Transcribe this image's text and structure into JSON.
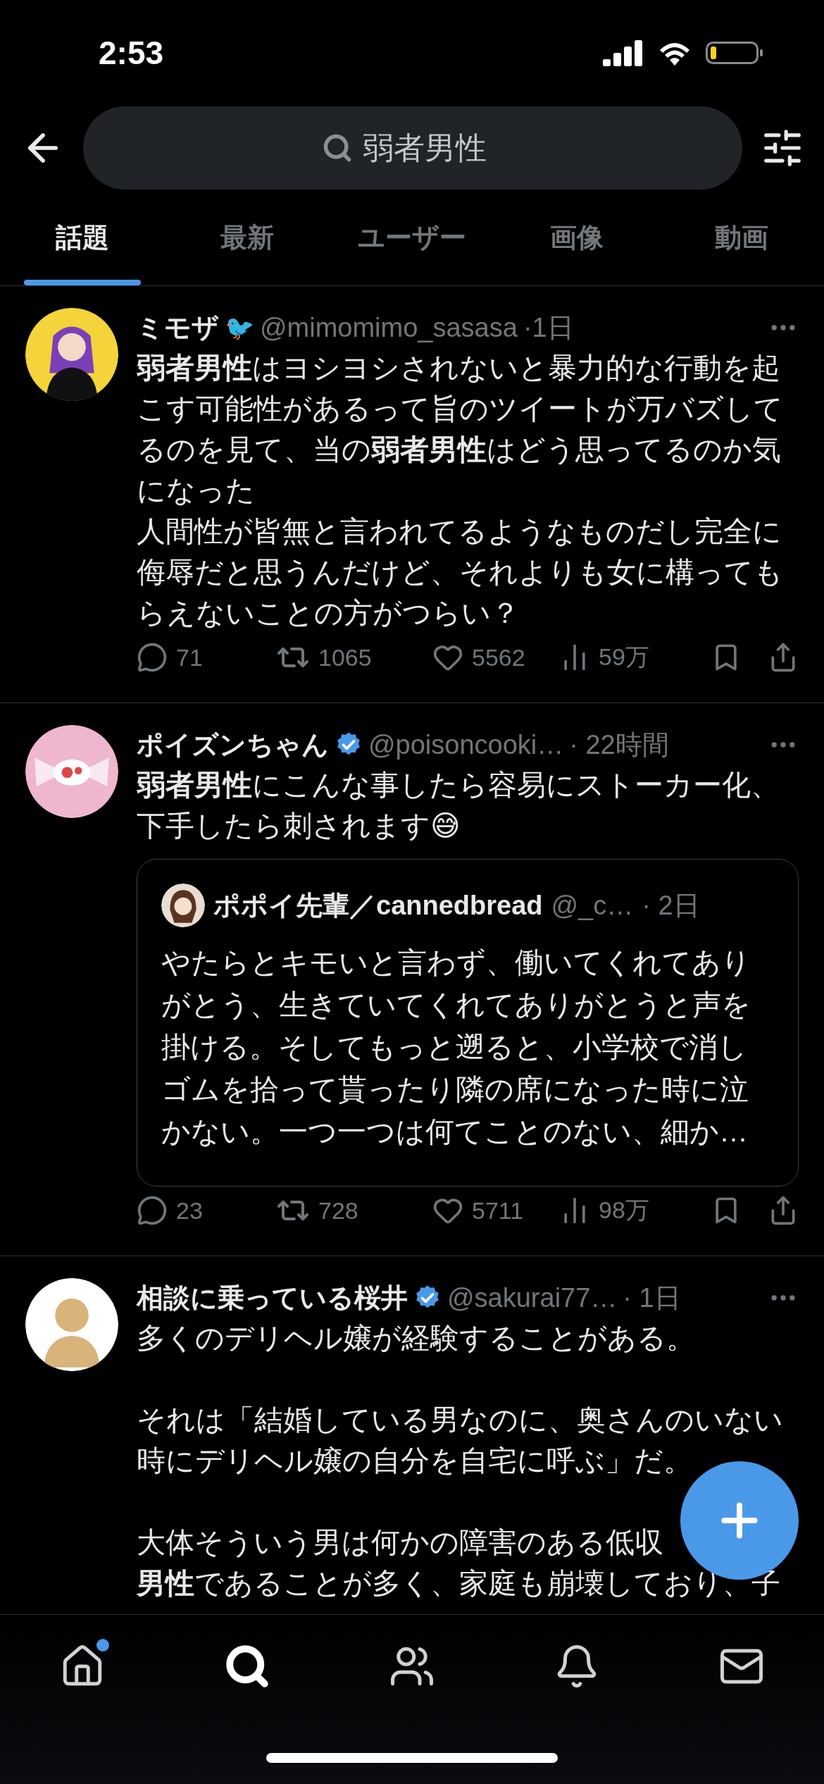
{
  "status_bar": {
    "time": "2:53"
  },
  "search": {
    "value": "弱者男性"
  },
  "tabs": [
    {
      "label": "話題",
      "selected": true
    },
    {
      "label": "最新",
      "selected": false
    },
    {
      "label": "ユーザー",
      "selected": false
    },
    {
      "label": "画像",
      "selected": false
    },
    {
      "label": "動画",
      "selected": false
    }
  ],
  "tweets": [
    {
      "name": "ミモザ",
      "name_emoji": "🐦",
      "verified": false,
      "handle": "@mimomimo_sasasa",
      "time": "·1日",
      "paragraphs": [
        [
          "**弱者男性**はヨシヨシされないと暴力的な行動を起こす可能性があるって旨のツイートが万バズしてるのを見て、当の**弱者男性**はどう思ってるのか気になった",
          "人間性が皆無と言われてるようなものだし完全に侮辱だと思うんだけど、それよりも女に構ってもらえないことの方がつらい？"
        ]
      ],
      "stats": {
        "replies": "71",
        "reposts": "1065",
        "likes": "5562",
        "views": "59万"
      }
    },
    {
      "name": "ポイズンちゃん",
      "verified": true,
      "handle": "@poisoncooki…",
      "time": "· 22時間",
      "paragraphs": [
        [
          "**弱者男性**にこんな事したら容易にストーカー化、下手したら刺されます😅"
        ]
      ],
      "quote": {
        "name": "ポポイ先輩／cannedbread",
        "handle": "@_c…",
        "time": "· 2日",
        "body": "やたらとキモいと言わず、働いてくれてありがとう、生きていてくれてありがとうと声を掛ける。そしてもっと遡ると、小学校で消しゴムを拾って貰ったり隣の席になった時に泣かない。一つ一つは何てことのない、細か…"
      },
      "stats": {
        "replies": "23",
        "reposts": "728",
        "likes": "5711",
        "views": "98万"
      }
    },
    {
      "name": "相談に乗っている桜井",
      "verified": true,
      "handle": "@sakurai77…",
      "time": "· 1日",
      "paragraphs": [
        [
          "多くのデリヘル嬢が経験することがある。"
        ],
        [
          "それは「結婚している男なのに、奥さんのいない時にデリヘル嬢の自分を自宅に呼ぶ」だ。"
        ],
        [
          "大体そういう男は何かの障害のある低収",
          "**男性**であることが多く、家庭も崩壊しており、子"
        ]
      ]
    }
  ],
  "nav": [
    {
      "kind": "home",
      "selected": false,
      "unread": true
    },
    {
      "kind": "search",
      "selected": true,
      "unread": false
    },
    {
      "kind": "communities",
      "selected": false,
      "unread": false
    },
    {
      "kind": "notifications",
      "selected": false,
      "unread": false
    },
    {
      "kind": "messages",
      "selected": false,
      "unread": false
    }
  ]
}
